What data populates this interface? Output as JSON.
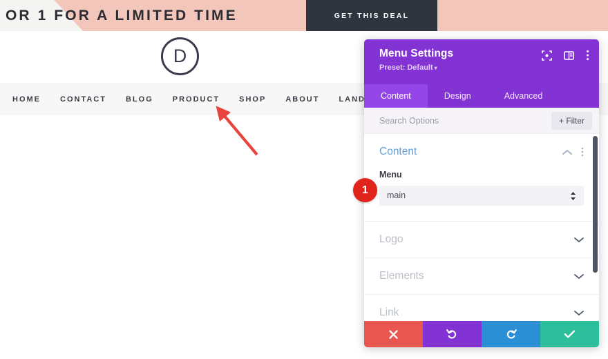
{
  "site": {
    "promo": {
      "text": "OR 1 FOR A LIMITED TIME",
      "cta_label": "GET THIS DEAL",
      "bar_color": "#f2c6ba",
      "cta_color": "#2e353e"
    },
    "logo": {
      "letter": "D",
      "name": "divi-logo"
    },
    "nav": {
      "items": [
        {
          "label": "HOME"
        },
        {
          "label": "CONTACT"
        },
        {
          "label": "BLOG"
        },
        {
          "label": "PRODUCT"
        },
        {
          "label": "SHOP"
        },
        {
          "label": "ABOUT"
        },
        {
          "label": "LANDING"
        }
      ]
    },
    "annotation": {
      "arrow_color": "#e8433c",
      "points_to": "SHOP"
    }
  },
  "modal": {
    "title": "Menu Settings",
    "preset_label": "Preset: Default",
    "preset_caret": "▾",
    "header_color": "#8333d4",
    "header_icons": [
      {
        "name": "focus-target-icon"
      },
      {
        "name": "panel-layout-icon"
      },
      {
        "name": "more-vertical-icon"
      }
    ],
    "tabs": [
      {
        "label": "Content",
        "active": true
      },
      {
        "label": "Design",
        "active": false
      },
      {
        "label": "Advanced",
        "active": false
      }
    ],
    "search": {
      "placeholder": "Search Options",
      "value": ""
    },
    "filter_button": {
      "label": "+ Filter"
    },
    "sections": [
      {
        "title": "Content",
        "open": true,
        "title_color": "#62a0d8",
        "fields": [
          {
            "label": "Menu",
            "type": "select",
            "value": "main"
          }
        ]
      },
      {
        "title": "Logo",
        "open": false
      },
      {
        "title": "Elements",
        "open": false
      },
      {
        "title": "Link",
        "open": false
      }
    ],
    "footer_actions": [
      {
        "name": "cancel",
        "glyph": "✕",
        "color": "#e9564f"
      },
      {
        "name": "undo",
        "glyph": "↺",
        "color": "#8333d4"
      },
      {
        "name": "redo",
        "glyph": "↻",
        "color": "#2a8fd4"
      },
      {
        "name": "save",
        "glyph": "✓",
        "color": "#2dbf9c"
      }
    ]
  },
  "step_badge": {
    "number": "1",
    "color": "#e0241c"
  }
}
